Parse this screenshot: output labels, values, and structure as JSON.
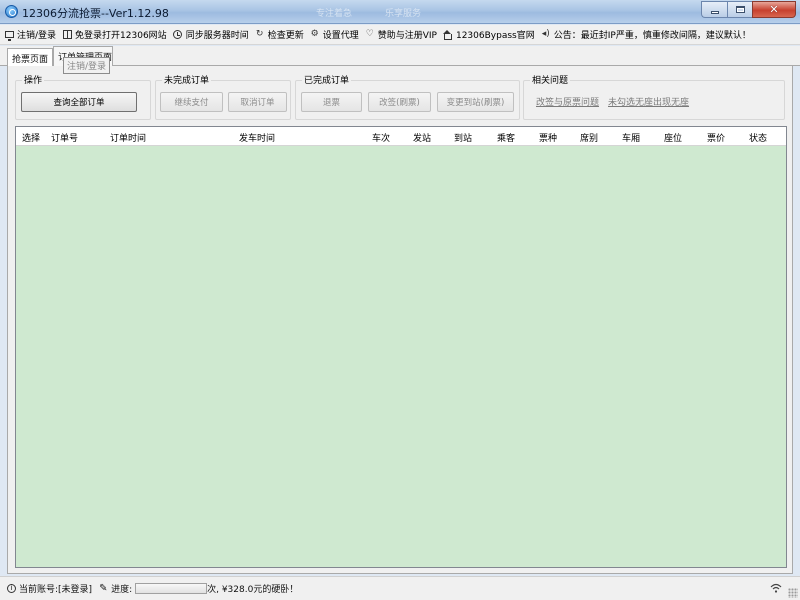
{
  "window": {
    "title": "12306分流抢票--Ver1.12.98",
    "ghost_text_1": "专注着急",
    "ghost_text_2": "乐享服务"
  },
  "menu": {
    "items": [
      {
        "label": "注销/登录",
        "icon": "monitor-icon"
      },
      {
        "label": "免登录打开12306网站",
        "icon": "window-icon"
      },
      {
        "label": "同步服务器时间",
        "icon": "clock-icon"
      },
      {
        "label": "检查更新",
        "icon": "refresh-icon"
      },
      {
        "label": "设置代理",
        "icon": "gear-icon"
      },
      {
        "label": "赞助与注册VIP",
        "icon": "heart-icon"
      },
      {
        "label": "12306Bypass官网",
        "icon": "home-icon"
      },
      {
        "label": "公告：最近封IP严重，慎重修改间隔，建议默认！",
        "icon": "speaker-icon"
      }
    ]
  },
  "tabs": [
    {
      "label": "抢票页面"
    },
    {
      "label": "订单管理页面"
    }
  ],
  "tooltip": "注销/登录",
  "groups": {
    "operations": {
      "legend": "操作",
      "buttons": [
        "查询全部订单"
      ]
    },
    "unfinished": {
      "legend": "未完成订单",
      "buttons": [
        "继续支付",
        "取消订单"
      ]
    },
    "finished": {
      "legend": "已完成订单",
      "buttons": [
        "退票",
        "改签(刷票)",
        "变更到站(刷票)"
      ]
    },
    "related": {
      "legend": "相关问题",
      "links": [
        "改签与原票问题",
        "未勾选无座出现无座"
      ]
    }
  },
  "table": {
    "columns": [
      "选择",
      "订单号",
      "订单时间",
      "发车时间",
      "车次",
      "发站",
      "到站",
      "乘客",
      "票种",
      "席别",
      "车厢",
      "座位",
      "票价",
      "状态"
    ],
    "rows": []
  },
  "status": {
    "account_label": "当前账号:[未登录]",
    "progress_label": "进度:",
    "progress_value": 0,
    "message": "次, ¥328.0元的硬卧！",
    "progress_color": "#06b025"
  }
}
